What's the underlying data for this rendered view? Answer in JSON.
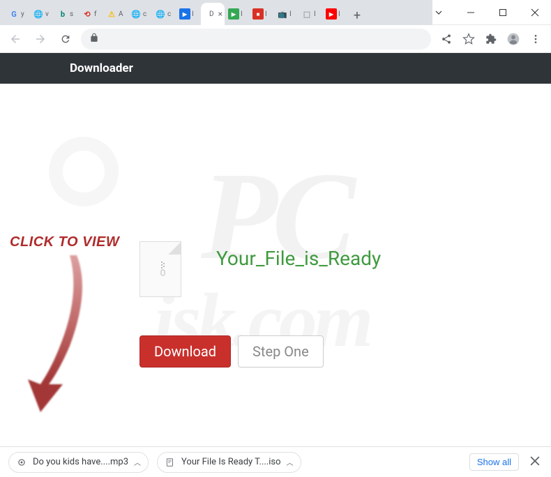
{
  "window": {
    "tabs": [
      {
        "letter": "G",
        "label": "y",
        "color": "#4285f4"
      },
      {
        "letter": "●",
        "label": "v",
        "color": "#888"
      },
      {
        "letter": "b",
        "label": "s",
        "color": "#008373"
      },
      {
        "letter": "⟲",
        "label": "f",
        "color": "#d93025"
      },
      {
        "letter": "⚠",
        "label": "A",
        "color": "#fbbc04"
      },
      {
        "letter": "●",
        "label": "c",
        "color": "#888"
      },
      {
        "letter": "●",
        "label": "c",
        "color": "#888"
      },
      {
        "letter": "▶",
        "label": "I",
        "color": "#1a73e8"
      },
      {
        "letter": "",
        "label": "D",
        "color": "#fff",
        "active": true
      },
      {
        "letter": "▶",
        "label": "I",
        "color": "#34a853"
      },
      {
        "letter": "■",
        "label": "I",
        "color": "#d93025"
      },
      {
        "letter": "▣",
        "label": "I",
        "color": "#444"
      },
      {
        "letter": "◇",
        "label": "I",
        "color": "#888"
      },
      {
        "letter": "▶",
        "label": "I",
        "color": "#ff0000"
      }
    ]
  },
  "page": {
    "header_title": "Downloader",
    "click_to_view": "CLICK TO VIEW",
    "main_text": "Your_File_is_Ready",
    "download_label": "Download",
    "step_one_label": "Step One",
    "watermark": "PC",
    "watermark_sub": "isk.com"
  },
  "downloads": {
    "items": [
      {
        "name": "Do you kids have....mp3",
        "type": "audio"
      },
      {
        "name": "Your File Is Ready T....iso",
        "type": "disc"
      }
    ],
    "show_all": "Show all"
  }
}
